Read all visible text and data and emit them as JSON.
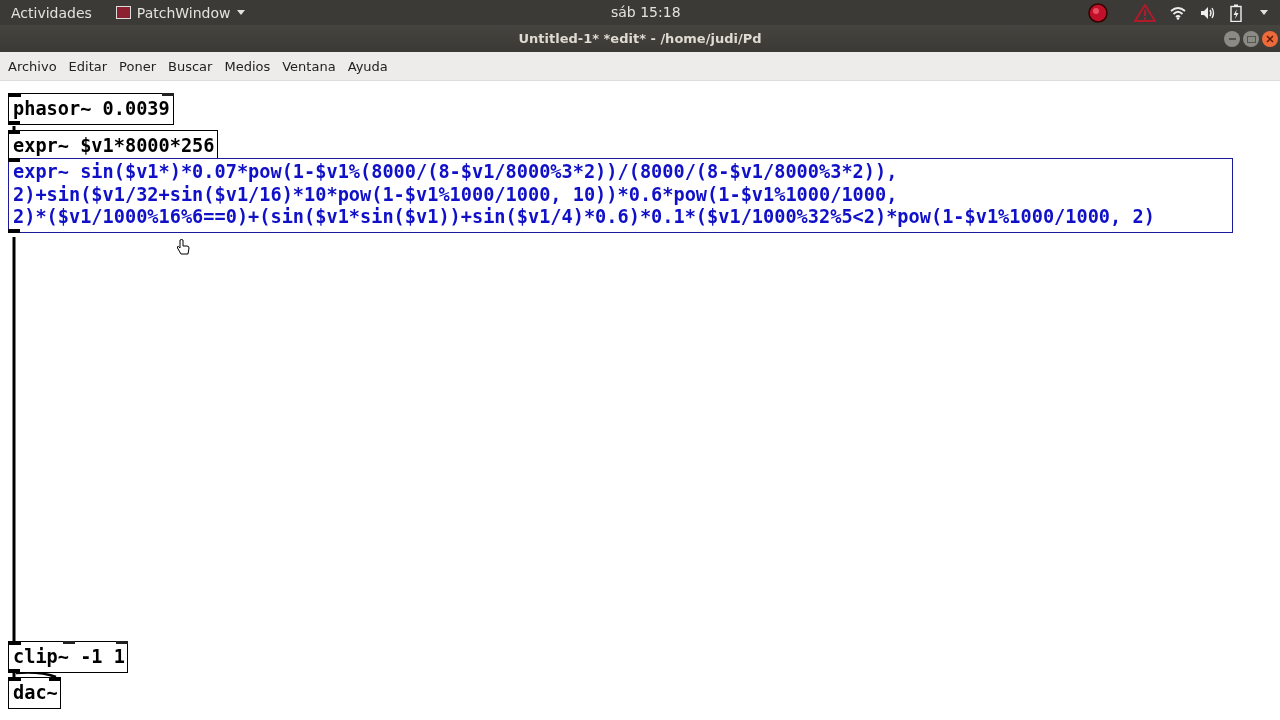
{
  "top_bar": {
    "activities": "Actividades",
    "app_menu": "PatchWindow",
    "clock": "sáb 15:18"
  },
  "window": {
    "title": "Untitled-1* *edit* - /home/judi/Pd"
  },
  "menu": [
    "Archivo",
    "Editar",
    "Poner",
    "Buscar",
    "Medios",
    "Ventana",
    "Ayuda"
  ],
  "objects": [
    {
      "lines": [
        "phasor~ 0.0039"
      ],
      "selected": false,
      "inlets": [
        {
          "kind": "signal"
        },
        {
          "kind": "control"
        }
      ],
      "outlets": [
        {
          "kind": "signal"
        }
      ]
    },
    {
      "lines": [
        "expr~ $v1*8000*256"
      ],
      "selected": false,
      "inlets": [
        {
          "kind": "signal"
        }
      ],
      "outlets": [
        {
          "kind": "signal"
        }
      ]
    },
    {
      "lines": [
        "expr~ sin($v1*)*0.07*pow(1-$v1%(8000/(8-$v1/8000%3*2))/(8000/(8-$v1/8000%3*2)),",
        "2)+sin($v1/32+sin($v1/16)*10*pow(1-$v1%1000/1000, 10))*0.6*pow(1-$v1%1000/1000,",
        "2)*($v1/1000%16%6==0)+(sin($v1*sin($v1))+sin($v1/4)*0.6)*0.1*($v1/1000%32%5<2)*pow(1-$v1%1000/1000, 2)"
      ],
      "selected": true,
      "inlets": [
        {
          "kind": "signal"
        }
      ],
      "outlets": [
        {
          "kind": "signal"
        }
      ]
    },
    {
      "lines": [
        "clip~ -1 1"
      ],
      "selected": false,
      "inlets": [
        {
          "kind": "signal"
        },
        {
          "kind": "control"
        },
        {
          "kind": "control"
        }
      ],
      "outlets": [
        {
          "kind": "signal"
        }
      ]
    },
    {
      "lines": [
        "dac~"
      ],
      "selected": false,
      "inlets": [
        {
          "kind": "signal"
        },
        {
          "kind": "signal"
        }
      ]
    }
  ]
}
